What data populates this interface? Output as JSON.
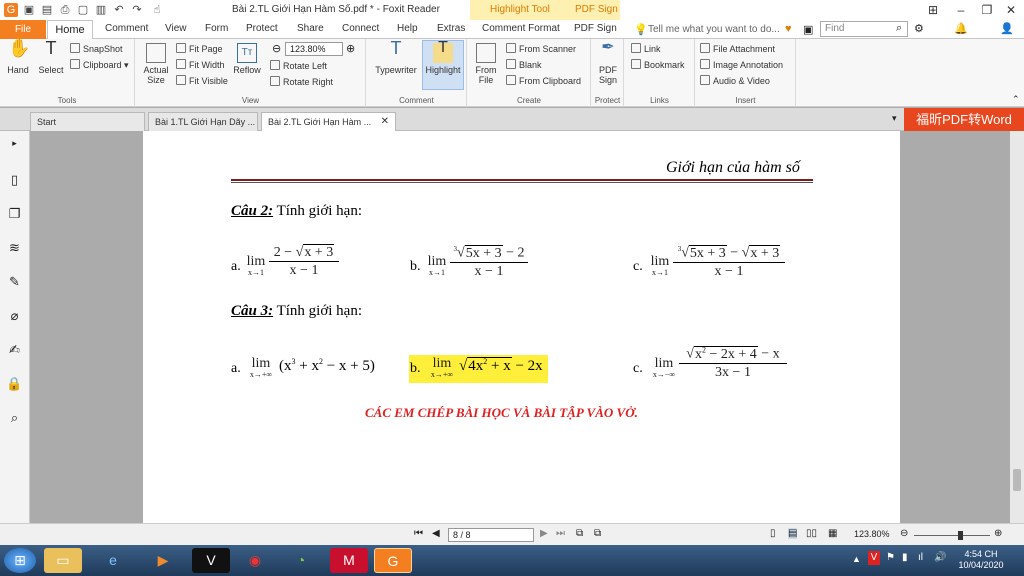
{
  "window": {
    "title": "Bài 2.TL Giới Hạn Hàm Số.pdf * - Foxit Reader",
    "context_tabs": [
      "Highlight Tool",
      "PDF Sign"
    ]
  },
  "ribbon_tabs": [
    "File",
    "Home",
    "Comment",
    "View",
    "Form",
    "Protect",
    "Share",
    "Connect",
    "Help",
    "Extras",
    "Comment Format",
    "PDF Sign"
  ],
  "tell_me": "Tell me what you want to do...",
  "find_placeholder": "Find",
  "ribbon": {
    "tools": {
      "hand": "Hand",
      "select": "Select",
      "snapshot": "SnapShot",
      "clipboard": "Clipboard",
      "label": "Tools"
    },
    "view": {
      "actual_size": "Actual Size",
      "fit_page": "Fit Page",
      "fit_width": "Fit Width",
      "fit_visible": "Fit Visible",
      "reflow": "Reflow",
      "zoom": "123.80%",
      "rotate_left": "Rotate Left",
      "rotate_right": "Rotate Right",
      "label": "View"
    },
    "comment": {
      "typewriter": "Typewriter",
      "highlight": "Highlight",
      "label": "Comment"
    },
    "create": {
      "from_file": "From File",
      "from_scanner": "From Scanner",
      "blank": "Blank",
      "from_clipboard": "From Clipboard",
      "label": "Create"
    },
    "protect": {
      "pdf_sign": "PDF Sign",
      "label": "Protect"
    },
    "links": {
      "link": "Link",
      "bookmark": "Bookmark",
      "label": "Links"
    },
    "insert": {
      "file_attachment": "File Attachment",
      "image_annotation": "Image Annotation",
      "audio_video": "Audio & Video",
      "label": "Insert"
    }
  },
  "doc_tabs": [
    "Start",
    "Bài 1.TL Giới Hạn Dãy ...",
    "Bài 2.TL Giới Hạn Hàm ..."
  ],
  "promo": "福昕PDF转Word",
  "document": {
    "header": "Giới hạn của hàm số",
    "q2_label": "Câu 2:",
    "q2_text": "Tính giới hạn:",
    "q3_label": "Câu 3:",
    "q3_text": "Tính giới hạn:",
    "footer_note": "CÁC EM CHÉP BÀI HỌC VÀ BÀI TẬP VÀO VỞ."
  },
  "status": {
    "page": "8 / 8",
    "zoom": "123.80%"
  },
  "clock": {
    "time": "4:54 CH",
    "date": "10/04/2020"
  }
}
